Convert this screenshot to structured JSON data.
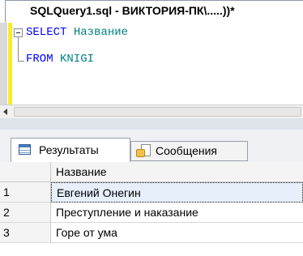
{
  "document_tab": {
    "title": "SQLQuery1.sql - ВИКТОРИЯ-ПК\\.....))*"
  },
  "editor": {
    "lines": [
      {
        "keyword": "SELECT",
        "identifier": "Название"
      },
      {
        "keyword": "FROM",
        "identifier": "KNIGI"
      }
    ]
  },
  "results_tabs": {
    "results_label": "Результаты",
    "messages_label": "Сообщения",
    "results_icon": "grid-icon",
    "messages_icon": "messages-icon"
  },
  "grid": {
    "columns": [
      "Название"
    ],
    "rows": [
      {
        "num": "1",
        "value": "Евгений Онегин"
      },
      {
        "num": "2",
        "value": "Преступление и наказание"
      },
      {
        "num": "3",
        "value": "Горе от ума"
      }
    ]
  },
  "colors": {
    "keyword": "#0000ff",
    "identifier": "#008080",
    "change_bar": "#f7ec2e"
  }
}
